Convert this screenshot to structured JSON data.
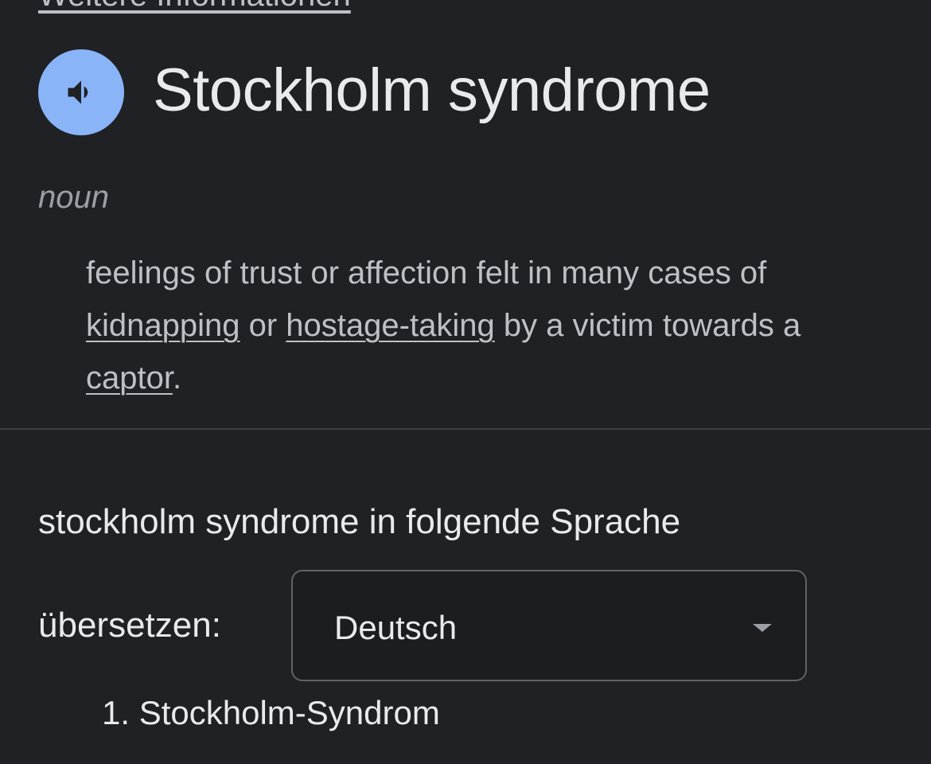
{
  "top_link": {
    "label": "Weitere Informationen"
  },
  "entry": {
    "headword": "Stockholm syndrome",
    "speaker_icon": "speaker-volume-icon",
    "part_of_speech": "noun",
    "definition": {
      "part1": "feelings of trust or affection felt in many cases of ",
      "link1": "kidnapping",
      "part2": " or ",
      "link2": "hostage-taking",
      "part3": " by a victim towards a ",
      "link3": "captor",
      "part4": "."
    }
  },
  "translation": {
    "heading": "stockholm syndrome in folgende Sprache",
    "label": "übersetzen:",
    "selected_language": "Deutsch",
    "dropdown_icon": "caret-down-icon",
    "results": [
      {
        "number": "1.",
        "text": "Stockholm-Syndrom"
      }
    ]
  },
  "colors": {
    "background": "#202124",
    "accent": "#8ab4f8",
    "primary_text": "#e8eaed",
    "secondary_text": "#bdc1c6",
    "muted_text": "#9aa0a6"
  }
}
